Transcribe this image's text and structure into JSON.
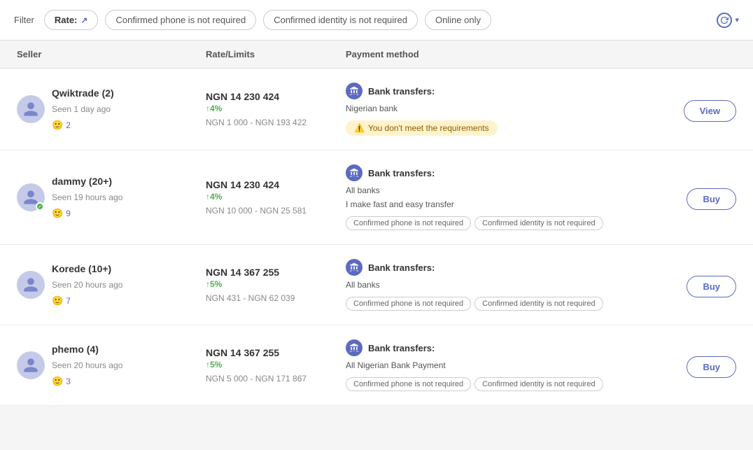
{
  "header": {
    "filter_label": "Filter",
    "rate_btn_label": "Rate:",
    "rate_arrow": "↗",
    "chips": [
      {
        "id": "confirmed-phone",
        "label": "Confirmed phone is not required"
      },
      {
        "id": "confirmed-identity",
        "label": "Confirmed identity is not required"
      },
      {
        "id": "online-only",
        "label": "Online only"
      }
    ],
    "refresh_tooltip": "Refresh"
  },
  "columns": {
    "seller": "Seller",
    "rate_limits": "Rate/Limits",
    "payment_method": "Payment method"
  },
  "listings": [
    {
      "id": 1,
      "seller_name": "Qwiktrade (2)",
      "seller_seen": "Seen 1 day ago",
      "seller_rating": "2",
      "verified": false,
      "rate": "NGN 14 230 424",
      "rate_change": "↑4%",
      "limits": "NGN 1 000 - NGN 193 422",
      "payment_type": "Bank transfers:",
      "payment_sub": "Nigerian bank",
      "tags": [],
      "warning": "You don't meet the requirements",
      "action": "View",
      "action_type": "view"
    },
    {
      "id": 2,
      "seller_name": "dammy (20+)",
      "seller_seen": "Seen 19 hours ago",
      "seller_rating": "9",
      "verified": true,
      "rate": "NGN 14 230 424",
      "rate_change": "↑4%",
      "limits": "NGN 10 000 - NGN 25 581",
      "payment_type": "Bank transfers:",
      "payment_sub": "All banks\nI make fast and easy transfer",
      "tags": [
        "Confirmed phone is not required",
        "Confirmed identity is not required"
      ],
      "warning": null,
      "action": "Buy",
      "action_type": "buy"
    },
    {
      "id": 3,
      "seller_name": "Korede (10+)",
      "seller_seen": "Seen 20 hours ago",
      "seller_rating": "7",
      "verified": false,
      "rate": "NGN 14 367 255",
      "rate_change": "↑5%",
      "limits": "NGN 431 - NGN 62 039",
      "payment_type": "Bank transfers:",
      "payment_sub": "All banks",
      "tags": [
        "Confirmed phone is not required",
        "Confirmed identity is not required"
      ],
      "warning": null,
      "action": "Buy",
      "action_type": "buy"
    },
    {
      "id": 4,
      "seller_name": "phemo (4)",
      "seller_seen": "Seen 20 hours ago",
      "seller_rating": "3",
      "verified": false,
      "rate": "NGN 14 367 255",
      "rate_change": "↑5%",
      "limits": "NGN 5 000 - NGN 171 867",
      "payment_type": "Bank transfers:",
      "payment_sub": "All Nigerian Bank Payment",
      "tags": [
        "Confirmed phone is not required",
        "Confirmed identity is not required"
      ],
      "warning": null,
      "action": "Buy",
      "action_type": "buy"
    }
  ]
}
